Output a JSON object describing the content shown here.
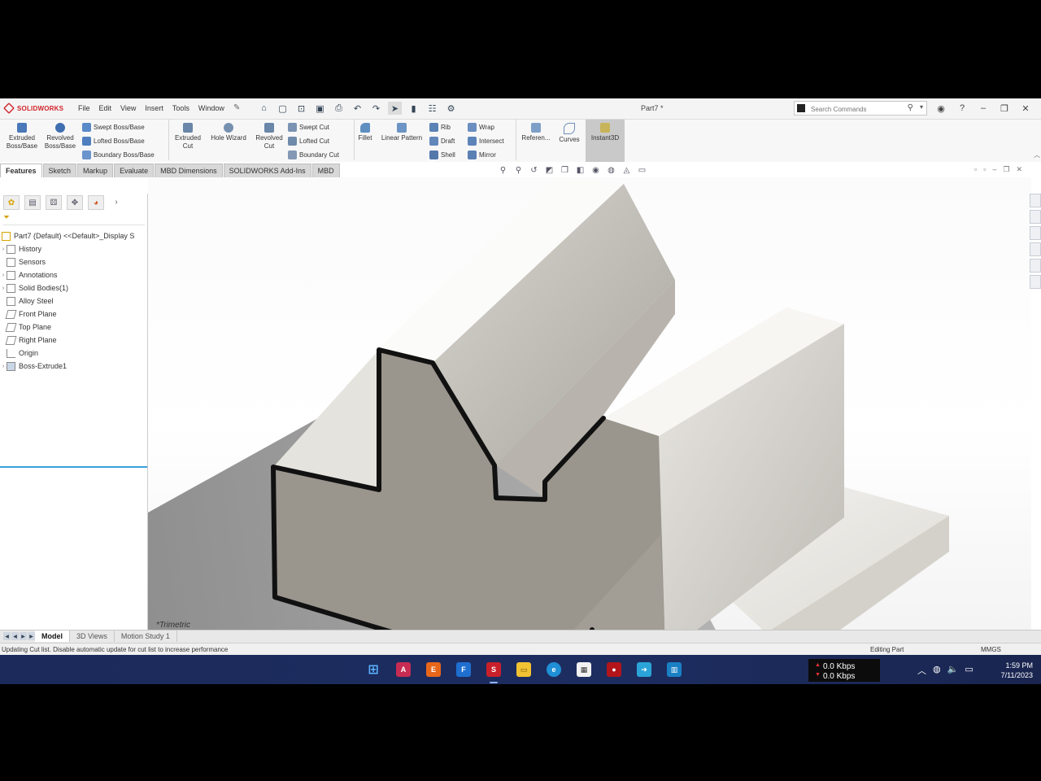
{
  "app": {
    "brand": "SOLIDWORKS",
    "menu": [
      "File",
      "Edit",
      "View",
      "Insert",
      "Tools",
      "Window"
    ],
    "document_title": "Part7 *",
    "search_placeholder": "Search Commands"
  },
  "commands": {
    "extruded_boss": "Extruded\nBoss/Base",
    "revolved_boss": "Revolved\nBoss/Base",
    "swept_boss": "Swept Boss/Base",
    "lofted_boss": "Lofted Boss/Base",
    "boundary_boss": "Boundary Boss/Base",
    "extruded_cut": "Extruded\nCut",
    "hole_wizard": "Hole Wizard",
    "revolved_cut": "Revolved\nCut",
    "swept_cut": "Swept Cut",
    "lofted_cut": "Lofted Cut",
    "boundary_cut": "Boundary Cut",
    "fillet": "Fillet",
    "linear_pattern": "Linear Pattern",
    "rib": "Rib",
    "draft": "Draft",
    "shell": "Shell",
    "wrap": "Wrap",
    "intersect": "Intersect",
    "mirror": "Mirror",
    "reference": "Referen...",
    "curves": "Curves",
    "instant3d": "Instant3D"
  },
  "tabs": [
    "Features",
    "Sketch",
    "Markup",
    "Evaluate",
    "MBD Dimensions",
    "SOLIDWORKS Add-Ins",
    "MBD"
  ],
  "feature_tree": {
    "root": "Part7 (Default) <<Default>_Display S",
    "items": [
      "History",
      "Sensors",
      "Annotations",
      "Solid Bodies(1)",
      "Alloy Steel",
      "Front Plane",
      "Top Plane",
      "Right Plane",
      "Origin",
      "Boss-Extrude1"
    ]
  },
  "viewport": {
    "view_label": "*Trimetric"
  },
  "bottom_tabs": [
    "Model",
    "3D Views",
    "Motion Study 1"
  ],
  "status": {
    "message": "Updating Cut list. Disable automatic update for cut list to increase performance",
    "mode": "Editing Part",
    "units": "MMGS"
  },
  "taskbar": {
    "net_up": "0.0 Kbps",
    "net_down": "0.0 Kbps",
    "time": "1:59 PM",
    "date": "7/11/2023"
  },
  "colors": {
    "brand_red": "#d2232a",
    "taskbar_bg": "#1b2a5a",
    "tree_highlight": "#3aa0d8"
  }
}
